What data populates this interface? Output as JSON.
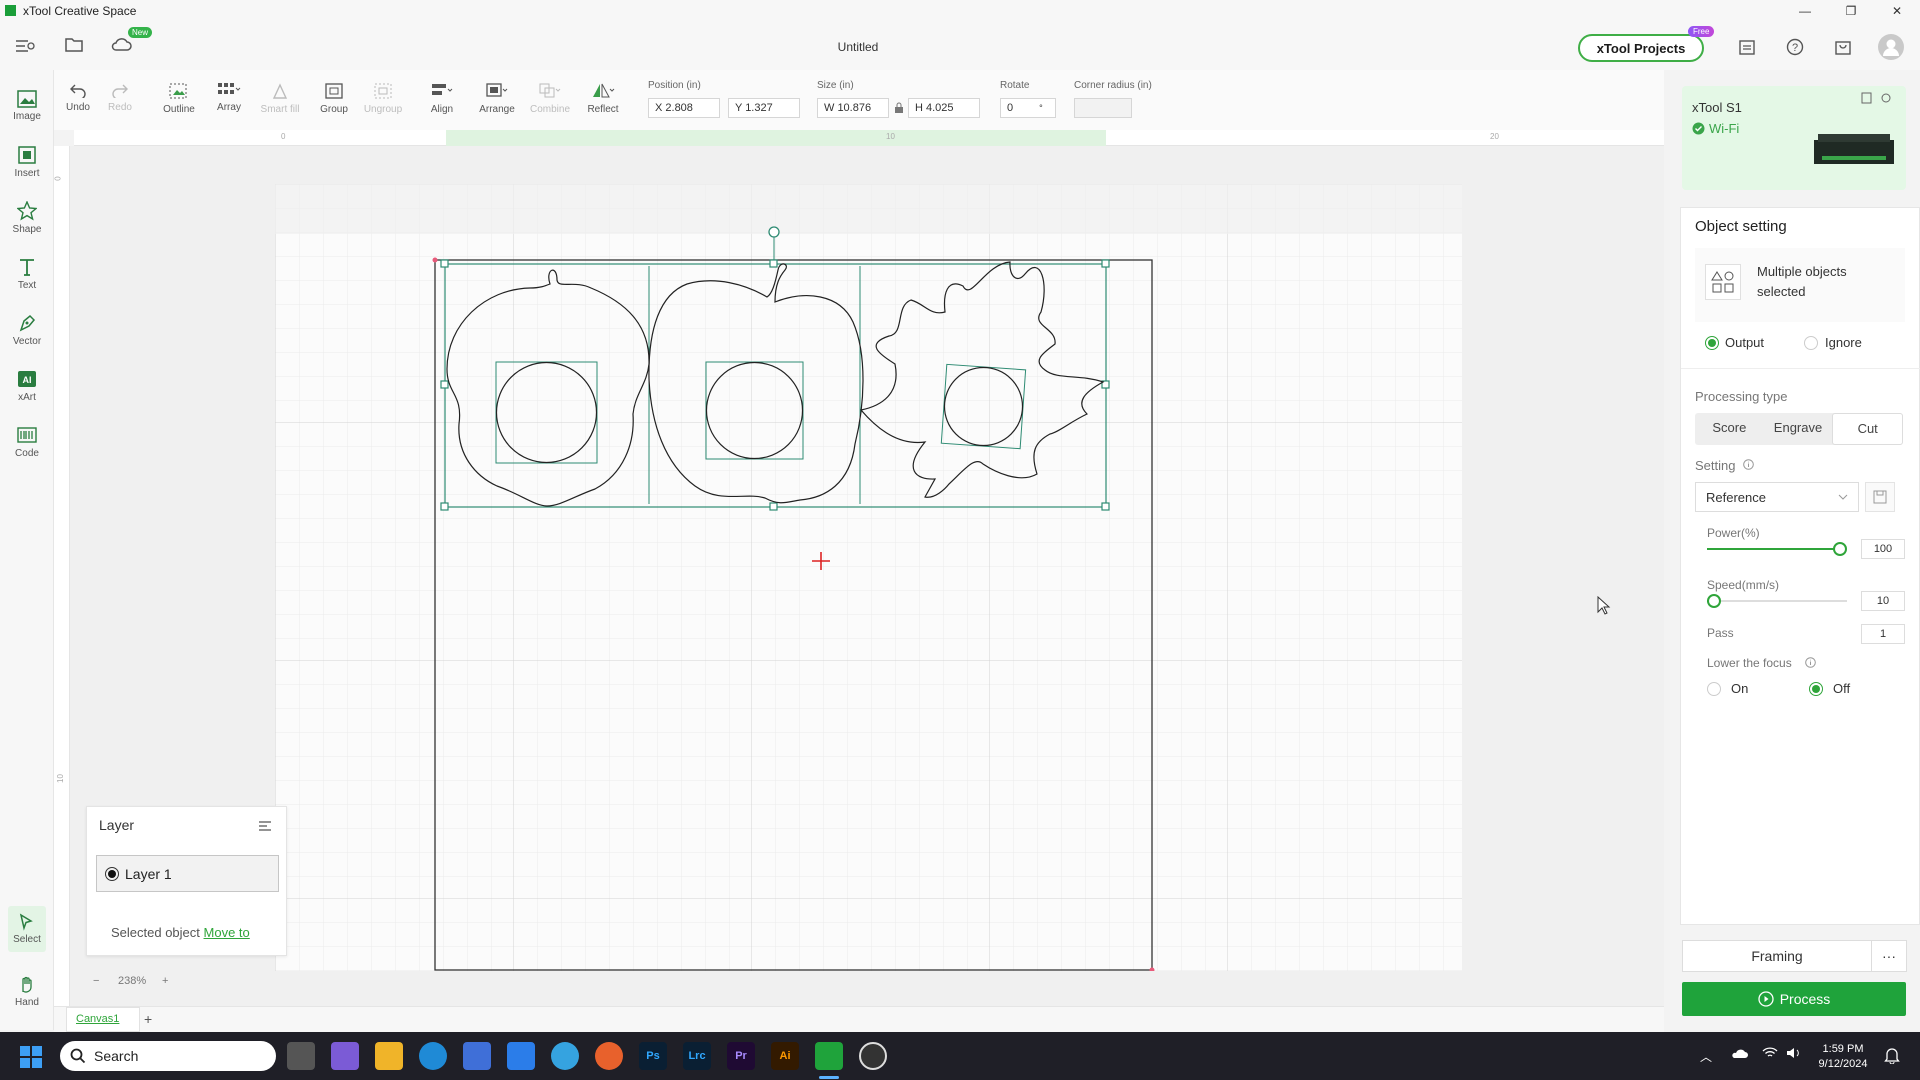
{
  "window": {
    "title": "xTool Creative Space",
    "doc_title": "Untitled"
  },
  "topbar": {
    "new_badge": "New",
    "projects_label": "xTool Projects",
    "free_badge": "Free"
  },
  "leftrail": {
    "items": [
      {
        "label": "Image"
      },
      {
        "label": "Insert"
      },
      {
        "label": "Shape"
      },
      {
        "label": "Text"
      },
      {
        "label": "Vector"
      },
      {
        "label": "xArt"
      },
      {
        "label": "Code"
      }
    ],
    "select_label": "Select",
    "hand_label": "Hand"
  },
  "toolbar": {
    "undo": "Undo",
    "redo": "Redo",
    "outline": "Outline",
    "array": "Array",
    "smart_fill": "Smart fill",
    "group": "Group",
    "ungroup": "Ungroup",
    "align": "Align",
    "arrange": "Arrange",
    "combine": "Combine",
    "reflect": "Reflect",
    "position_label": "Position (in)",
    "x_value": "X 2.808",
    "y_value": "Y 1.327",
    "size_label": "Size (in)",
    "w_value": "W 10.876",
    "h_value": "H 4.025",
    "rotate_label": "Rotate",
    "rotate_value": "0",
    "rotate_unit": "°",
    "corner_label": "Corner radius (in)",
    "corner_value": ""
  },
  "rulers": {
    "h_ticks": [
      "0",
      "10",
      "20"
    ],
    "v_ticks": [
      "0",
      "10"
    ]
  },
  "layer_panel": {
    "title": "Layer",
    "layer_name": "Layer 1",
    "selected_text": "Selected object",
    "move_to": "Move to"
  },
  "zoom": {
    "minus": "−",
    "value": "238%",
    "plus": "+"
  },
  "canvas_tabs": {
    "tab": "Canvas1",
    "add": "+"
  },
  "device": {
    "name": "xTool S1",
    "connection": "Wi-Fi"
  },
  "object_setting": {
    "title": "Object setting",
    "multi_label": "Multiple objects selected",
    "output_label": "Output",
    "ignore_label": "Ignore",
    "output_selected": true,
    "processing_type_label": "Processing type",
    "processing_types": [
      "Score",
      "Engrave",
      "Cut"
    ],
    "active_processing": "Cut",
    "setting_label": "Setting",
    "setting_value": "Reference",
    "power_label": "Power(%)",
    "power_value": "100",
    "power_fraction": 1.0,
    "speed_label": "Speed(mm/s)",
    "speed_value": "10",
    "speed_fraction": 0.0,
    "pass_label": "Pass",
    "pass_value": "1",
    "focus_label": "Lower the focus",
    "focus_on": "On",
    "focus_off": "Off"
  },
  "actions": {
    "framing": "Framing",
    "more": "···",
    "process": "Process"
  },
  "taskbar": {
    "search": "Search",
    "time": "1:59 PM",
    "date": "9/12/2024"
  },
  "colors": {
    "accent": "#2fa53a",
    "process": "#1fa33b",
    "selection": "#2e8b73"
  }
}
